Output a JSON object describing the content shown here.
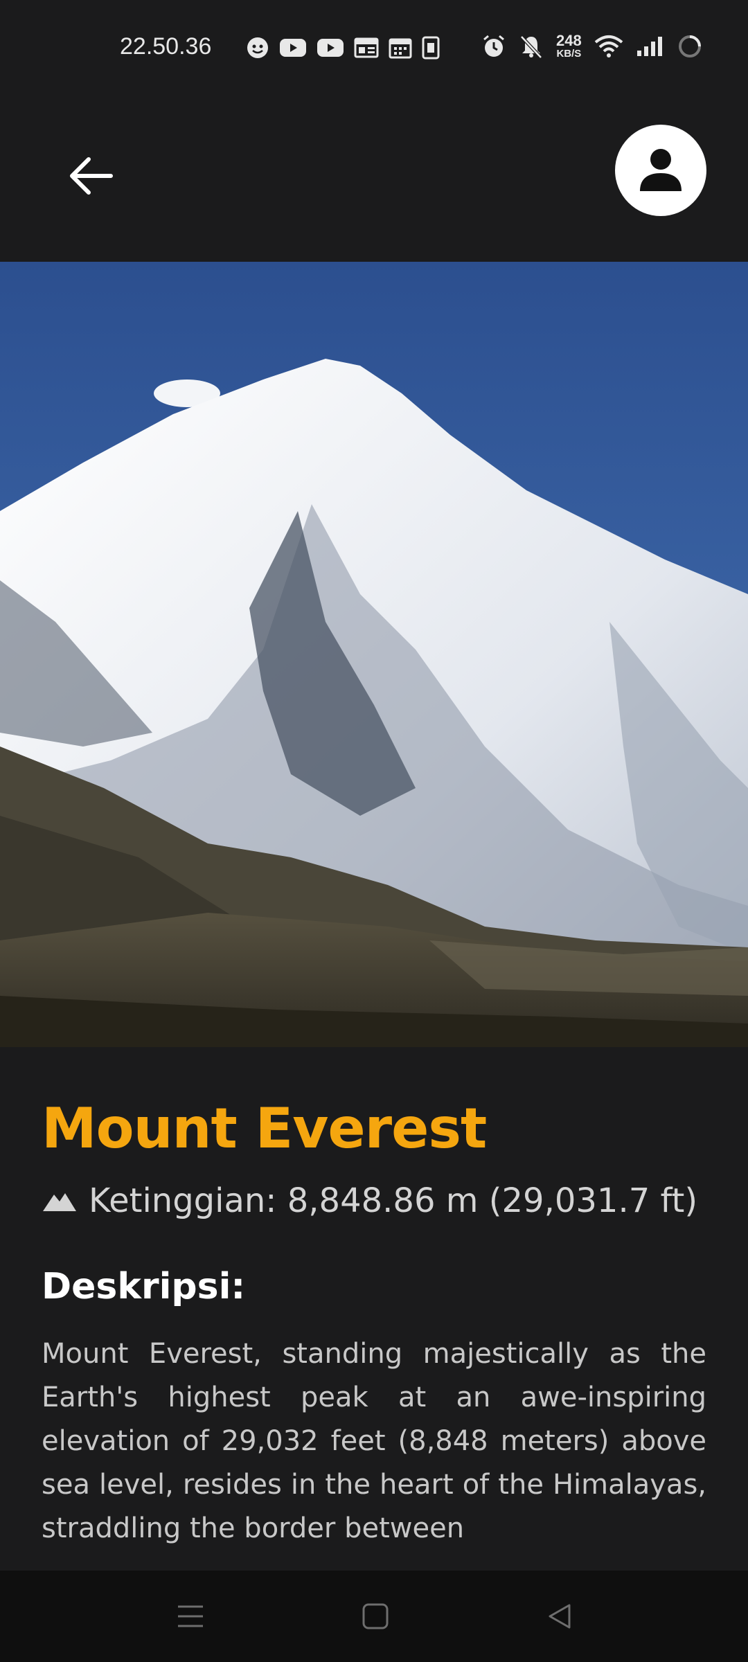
{
  "status_bar": {
    "time": "22.50.36",
    "net_speed_value": "248",
    "net_speed_unit": "KB/S",
    "left_icons": [
      "face-icon",
      "youtube-icon",
      "youtube-icon",
      "news-icon",
      "calendar-icon",
      "sim-icon"
    ],
    "right_icons": [
      "alarm-icon",
      "mute-icon",
      "wifi-icon",
      "signal-icon",
      "loading-icon"
    ]
  },
  "app_bar": {
    "back_icon": "arrow-left-icon",
    "profile_icon": "person-icon"
  },
  "mountain": {
    "name": "Mount Everest",
    "elevation_icon": "mountain-icon",
    "elevation": "Ketinggian: 8,848.86 m (29,031.7 ft)",
    "description_heading": "Deskripsi:",
    "description": "Mount Everest, standing majestically as the Earth's highest peak at an awe-inspiring elevation of 29,032 feet (8,848 meters) above sea level, resides in the heart of the Himalayas, straddling the border between"
  },
  "colors": {
    "background": "#1b1b1c",
    "title": "#f5a60f",
    "nav_bar": "#0f0f0f"
  },
  "nav_bar": {
    "icons": [
      "menu-icon",
      "home-icon",
      "back-icon"
    ]
  }
}
